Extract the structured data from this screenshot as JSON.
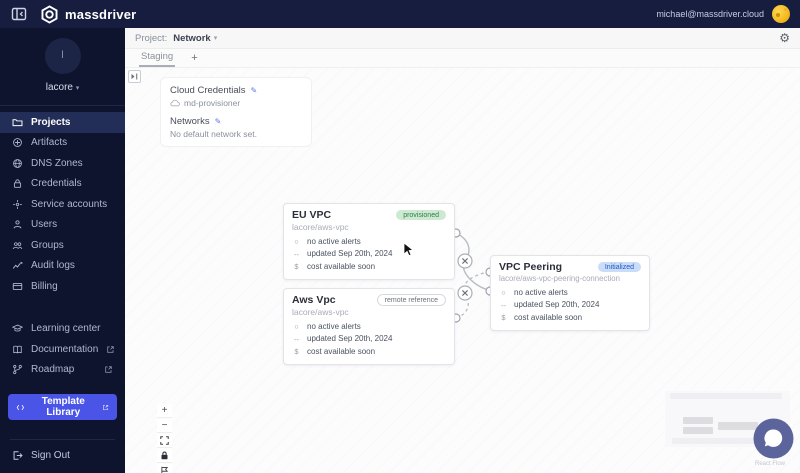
{
  "topbar": {
    "brand": "massdriver",
    "email": "michael@massdriver.cloud"
  },
  "sidebar": {
    "org": {
      "name": "lacore",
      "initial": "l",
      "caret": "▾"
    },
    "nav": [
      {
        "label": "Projects"
      },
      {
        "label": "Artifacts"
      },
      {
        "label": "DNS Zones"
      },
      {
        "label": "Credentials"
      },
      {
        "label": "Service accounts"
      },
      {
        "label": "Users"
      },
      {
        "label": "Groups"
      },
      {
        "label": "Audit logs"
      },
      {
        "label": "Billing"
      }
    ],
    "secondary": [
      {
        "label": "Learning center"
      },
      {
        "label": "Documentation"
      },
      {
        "label": "Roadmap"
      }
    ],
    "template_library": "Template Library",
    "sign_out": "Sign Out"
  },
  "header": {
    "project_label": "Project:",
    "project_name": "Network",
    "caret": "▾"
  },
  "tabs": {
    "staging": "Staging",
    "add": "+"
  },
  "canvas": {
    "info": {
      "credentials_title": "Cloud Credentials",
      "credentials_value": "md-provisioner",
      "networks_title": "Networks",
      "networks_value": "No default network set."
    },
    "nodes": [
      {
        "title": "EU VPC",
        "badge": "provisioned",
        "package": "lacore/aws-vpc",
        "alerts": "no active alerts",
        "updated": "updated Sep 20th, 2024",
        "cost": "cost available soon"
      },
      {
        "title": "Aws Vpc",
        "badge": "remote reference",
        "package": "lacore/aws-vpc",
        "alerts": "no active alerts",
        "updated": "updated Sep 20th, 2024",
        "cost": "cost available soon"
      },
      {
        "title": "VPC Peering",
        "badge": "Initialized",
        "package": "lacore/aws-vpc-peering-connection",
        "alerts": "no active alerts",
        "updated": "updated Sep 20th, 2024",
        "cost": "cost available soon"
      }
    ],
    "attribution": "React Flow",
    "colors": {
      "topbar_bg": "#161d3f",
      "sidebar_bg": "#0e142e",
      "accent": "#4a55e8",
      "provisioned_bg": "#cde9d2",
      "provisioned_text": "#2f7d43",
      "initialized_bg": "#c9ddf8",
      "initialized_text": "#2456c9",
      "avatar_gold": "#f4b921"
    }
  }
}
